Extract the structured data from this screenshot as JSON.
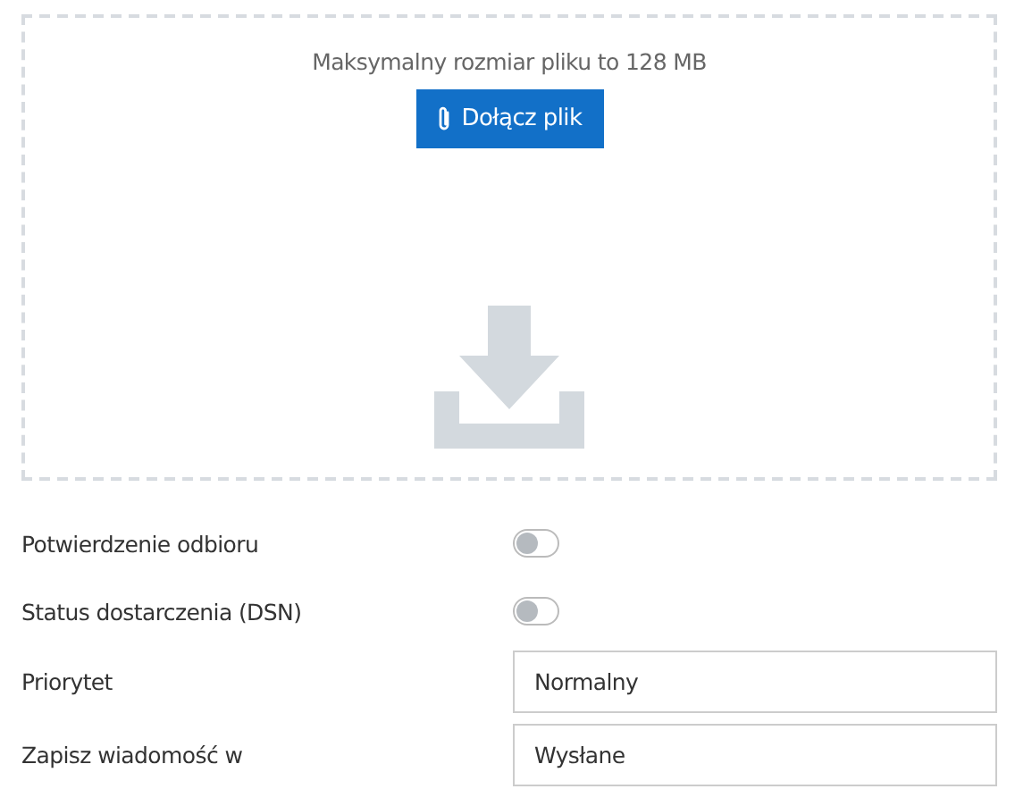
{
  "dropzone": {
    "hint": "Maksymalny rozmiar pliku to 128 MB",
    "button": "Dołącz plik"
  },
  "settings": [
    {
      "kind": "toggle",
      "label": "Potwierdzenie odbioru",
      "on": false
    },
    {
      "kind": "toggle",
      "label": "Status dostarczenia (DSN)",
      "on": false
    },
    {
      "kind": "field",
      "label": "Priorytet",
      "value": "Normalny"
    },
    {
      "kind": "field",
      "label": "Zapisz wiadomość w",
      "value": "Wysłane"
    }
  ]
}
